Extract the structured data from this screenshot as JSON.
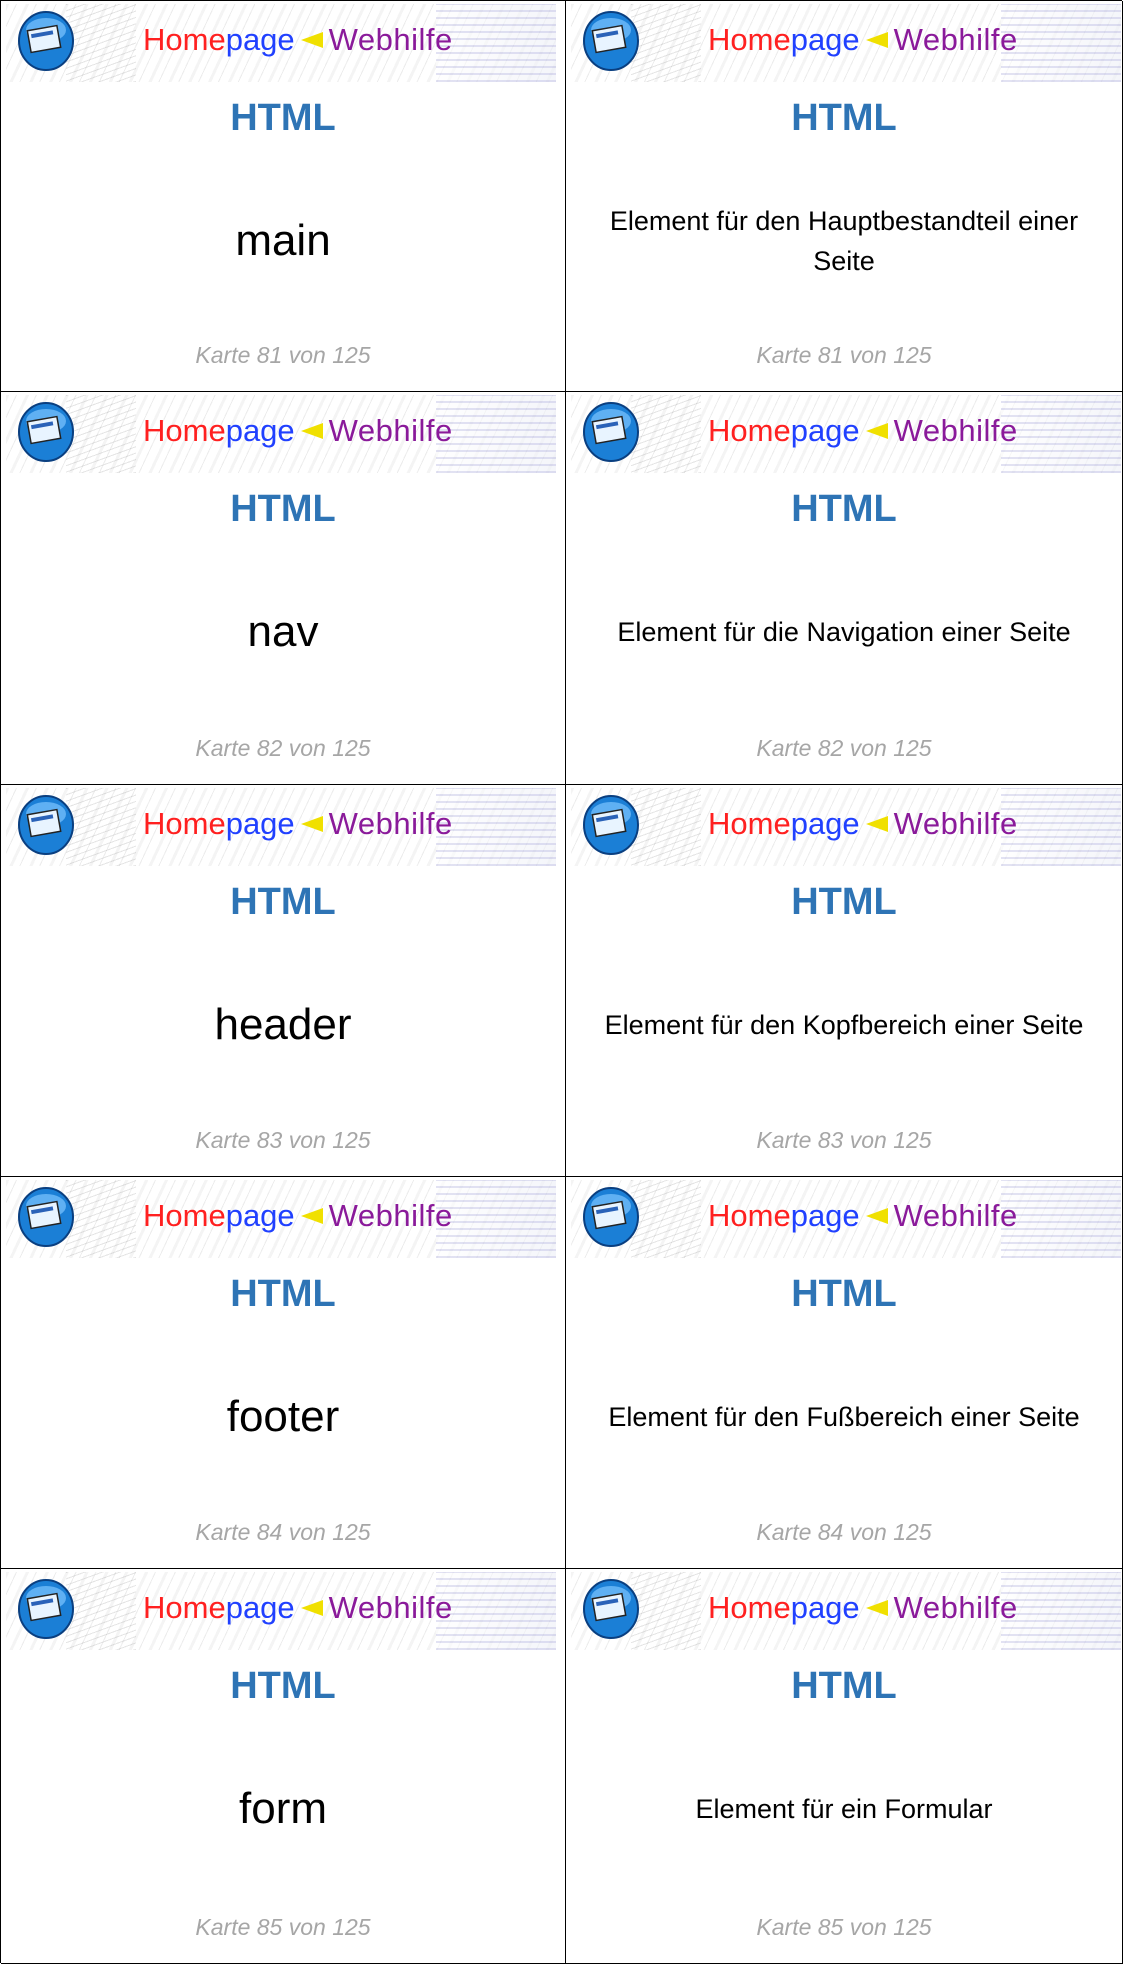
{
  "brand": {
    "part1": "Home",
    "part2": "page",
    "part3": "Webhilfe"
  },
  "cards": [
    {
      "subject": "HTML",
      "front": "main",
      "back": "Element für den Hauptbestandteil einer Seite",
      "counter": "Karte 81 von 125"
    },
    {
      "subject": "HTML",
      "front": "nav",
      "back": "Element für die Navigation einer Seite",
      "counter": "Karte 82 von 125"
    },
    {
      "subject": "HTML",
      "front": "header",
      "back": "Element für den Kopfbereich einer Seite",
      "counter": "Karte 83 von 125"
    },
    {
      "subject": "HTML",
      "front": "footer",
      "back": "Element für den Fußbereich einer Seite",
      "counter": "Karte 84 von 125"
    },
    {
      "subject": "HTML",
      "front": "form",
      "back": "Element für ein Formular",
      "counter": "Karte 85 von 125"
    }
  ],
  "colors": {
    "subject": "#2e74b5",
    "counter": "#a6a6a6",
    "brand_home": "#ff2020",
    "brand_page": "#2040ff",
    "brand_webhilfe": "#8a1a9a"
  }
}
